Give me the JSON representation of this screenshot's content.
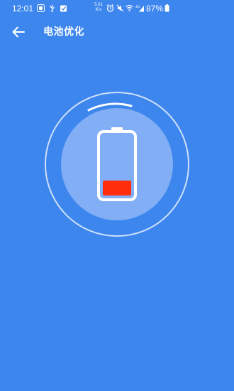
{
  "status_bar": {
    "time": "12:01",
    "net_speed_value": "5.01",
    "net_speed_unit": "K/s",
    "battery_percent": "87%",
    "icons": [
      "notification-icon",
      "usb-icon",
      "clipboard-icon",
      "alarm-icon",
      "mute-icon",
      "wifi-icon",
      "signal-4g-icon",
      "battery-icon"
    ]
  },
  "app_bar": {
    "back_icon": "arrow-left-icon",
    "title": "电池优化"
  },
  "gauge": {
    "charge_level": 0.25,
    "charge_color": "#ff2d0a",
    "background_color": "#3c86ee"
  }
}
